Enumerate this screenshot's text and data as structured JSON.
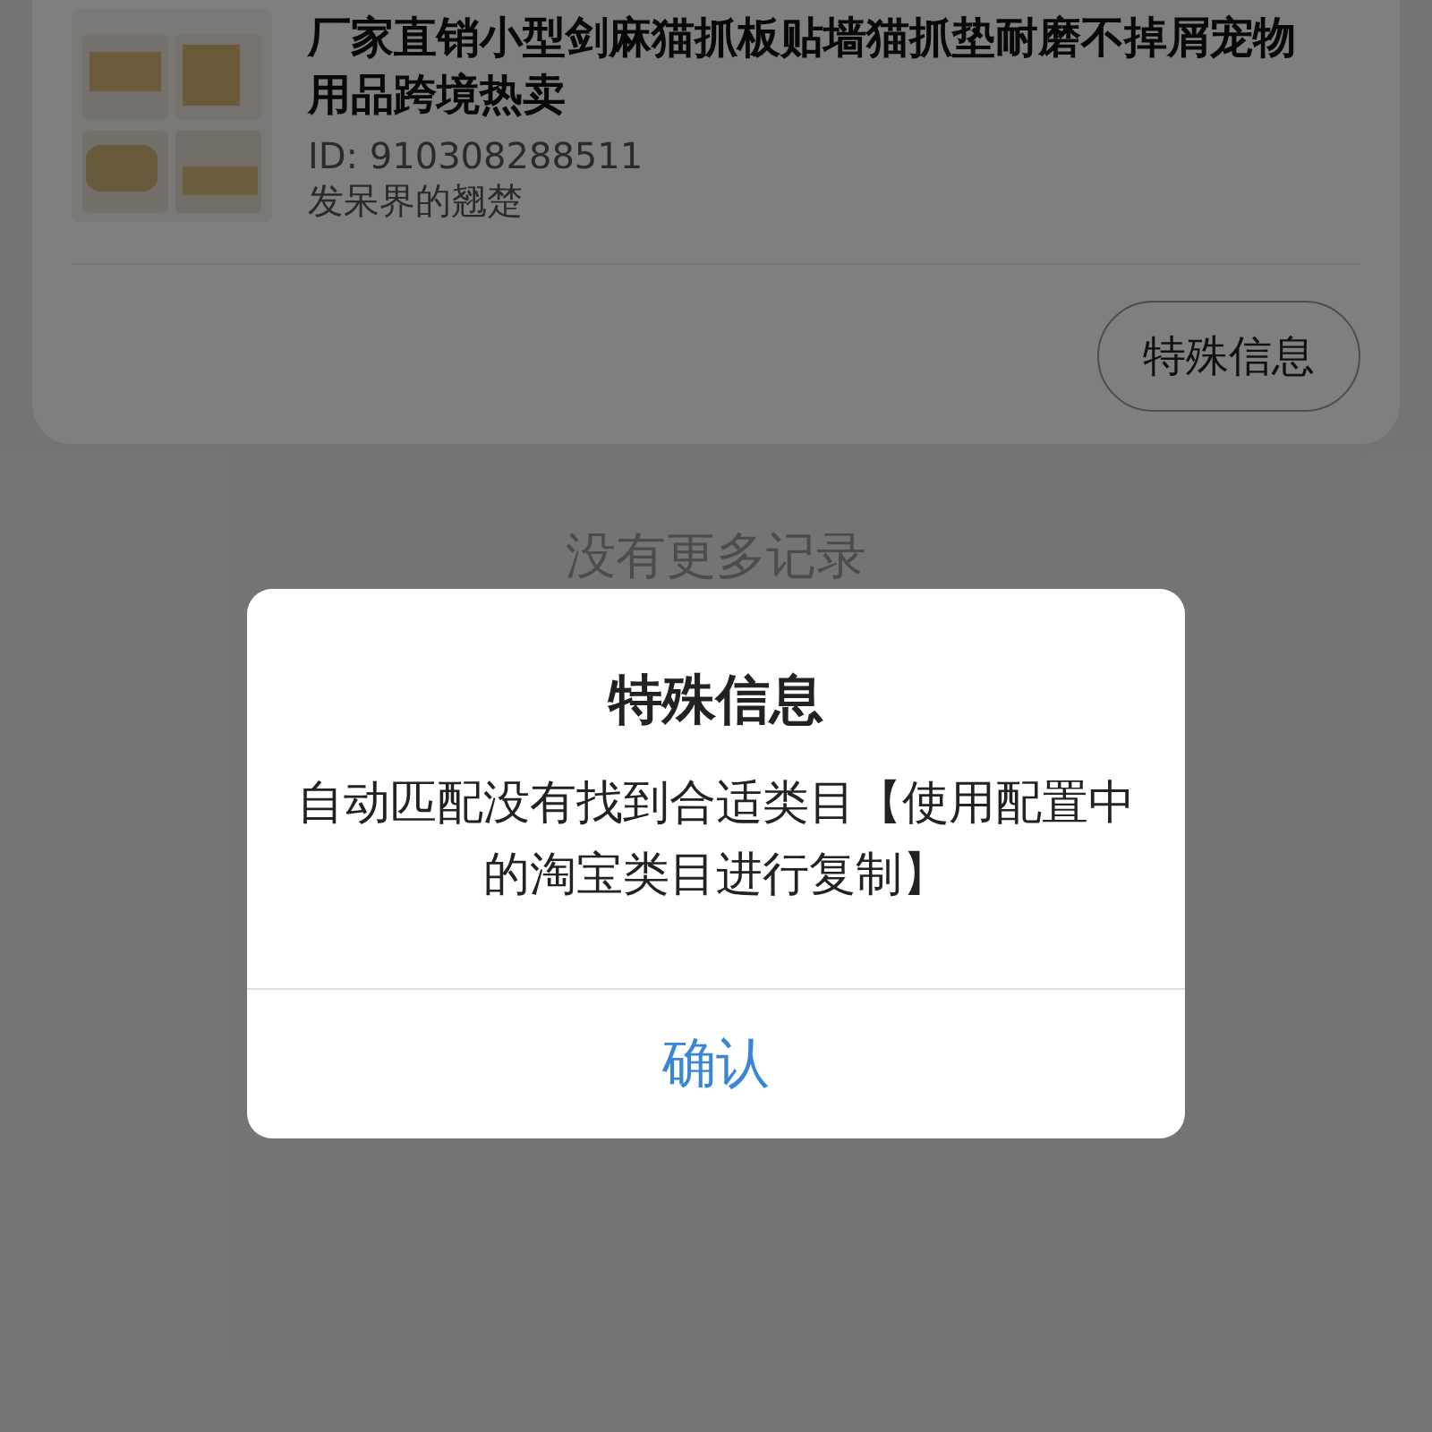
{
  "record": {
    "title": "厂家直销小型剑麻猫抓板贴墙猫抓垫耐磨不掉屑宠物用品跨境热卖",
    "id_text": "ID: 910308288511",
    "shop": "发呆界的翘楚",
    "button": "特殊信息"
  },
  "footer_note": "没有更多记录",
  "dialog": {
    "title": "特殊信息",
    "message": "自动匹配没有找到合适类目【使用配置中的淘宝类目进行复制】",
    "button": "确认"
  }
}
